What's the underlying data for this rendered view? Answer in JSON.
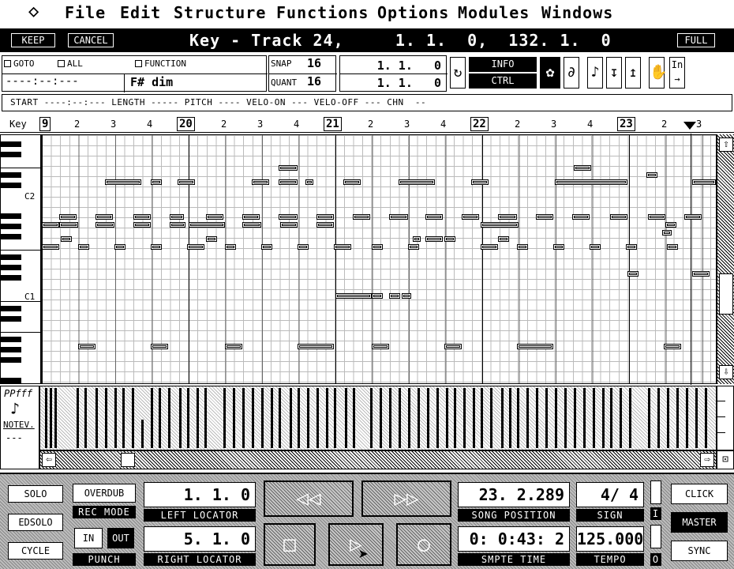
{
  "menu": {
    "logo": "◇",
    "items": [
      "File",
      "Edit",
      "Structure",
      "Functions",
      "Options",
      "Modules",
      "Windows"
    ]
  },
  "titlebar": {
    "keep": "KEEP",
    "cancel": "CANCEL",
    "title": "Key - Track 24,     1. 1.  0,  132. 1.  0",
    "full": "FULL"
  },
  "info": {
    "goto": "GOTO",
    "all": "ALL",
    "function": "FUNCTION",
    "position_blank": "----:--:---",
    "chord": "F# dim",
    "snap_label": "SNAP",
    "snap_value": "16",
    "quant_label": "QUANT",
    "quant_value": "16",
    "pos1": "1. 1.   0",
    "pos2": "1. 1.   0",
    "info_btn": "INFO",
    "ctrl_btn": "CTRL",
    "event_line": "START ----:--:--- LENGTH ----- PITCH ---- VELO-ON --- VELO-OFF --- CHN  --"
  },
  "ruler": {
    "key_label": "Key",
    "bars": [
      "9",
      "20",
      "21",
      "22",
      "23"
    ],
    "beats": [
      "2",
      "3",
      "4"
    ]
  },
  "keyboard": {
    "c2": "C2",
    "c1": "C1"
  },
  "velocity": {
    "dynamics": "PPfff",
    "label": "NOTEV.",
    "blank": "---"
  },
  "transport": {
    "solo": "SOLO",
    "edsolo": "EDSOLO",
    "cycle": "CYCLE",
    "overdub": "OVERDUB",
    "rec_mode": "REC MODE",
    "in": "IN",
    "out": "OUT",
    "punch": "PUNCH",
    "left_locator_val": "1. 1.  0",
    "left_locator": "LEFT LOCATOR",
    "right_locator_val": "5. 1.  0",
    "right_locator": "RIGHT LOCATOR",
    "song_pos_val": "23. 2.289",
    "song_position": "SONG POSITION",
    "smpte_val": "0: 0:43: 2",
    "smpte_time": "SMPTE TIME",
    "sign_val": "4/ 4",
    "sign": "SIGN",
    "tempo_val": "125.000",
    "tempo": "TEMPO",
    "i_label": "I",
    "o_label": "O",
    "click": "CLICK",
    "master": "MASTER",
    "sync": "SYNC"
  },
  "colors": {
    "background": "#ffffff",
    "foreground": "#000000",
    "panel": "#aaaaaa"
  }
}
